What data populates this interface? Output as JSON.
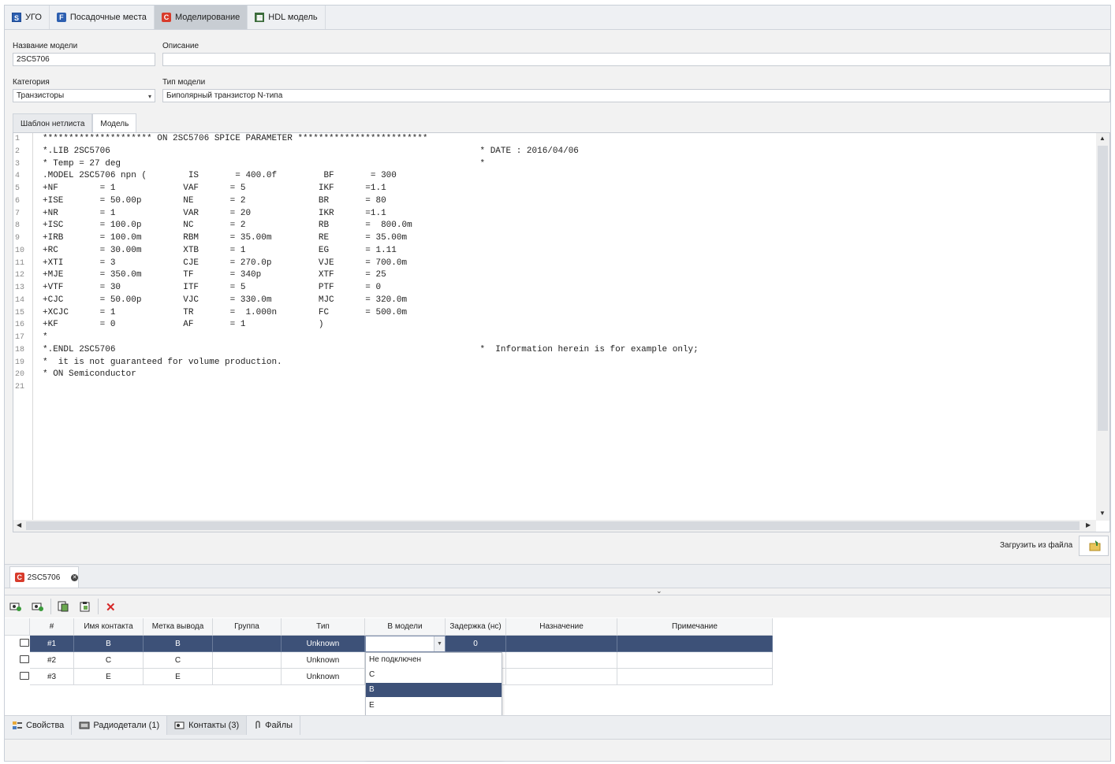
{
  "top_tabs": [
    {
      "label": "УГО",
      "icon": "s-icon"
    },
    {
      "label": "Посадочные места",
      "icon": "f-icon"
    },
    {
      "label": "Моделирование",
      "icon": "model-icon"
    },
    {
      "label": "HDL модель",
      "icon": "hdl-icon"
    }
  ],
  "form": {
    "model_name_label": "Название модели",
    "model_name_value": "2SC5706",
    "description_label": "Описание",
    "description_value": "",
    "category_label": "Категория",
    "category_value": "Транзисторы",
    "model_type_label": "Тип модели",
    "model_type_value": "Биполярный транзистор N-типа"
  },
  "inner_tabs": [
    {
      "label": "Шаблон нетлиста"
    },
    {
      "label": "Модель"
    }
  ],
  "code_lines": [
    "********************* ON 2SC5706 SPICE PARAMETER *************************",
    "*.LIB 2SC5706                                                                       * DATE : 2016/04/06",
    "* Temp = 27 deg                                                                     *",
    ".MODEL 2SC5706 npn (        IS       = 400.0f         BF       = 300",
    "+NF        = 1             VAF      = 5              IKF      =1.1",
    "+ISE       = 50.00p        NE       = 2              BR       = 80",
    "+NR        = 1             VAR      = 20             IKR      =1.1",
    "+ISC       = 100.0p        NC       = 2              RB       =  800.0m",
    "+IRB       = 100.0m        RBM      = 35.00m         RE       = 35.00m",
    "+RC        = 30.00m        XTB      = 1              EG       = 1.11",
    "+XTI       = 3             CJE      = 270.0p         VJE      = 700.0m",
    "+MJE       = 350.0m        TF       = 340p           XTF      = 25",
    "+VTF       = 30            ITF      = 5              PTF      = 0",
    "+CJC       = 50.00p        VJC      = 330.0m         MJC      = 320.0m",
    "+XCJC      = 1             TR       =  1.000n        FC       = 500.0m",
    "+KF        = 0             AF       = 1              )",
    "*",
    "*.ENDL 2SC5706                                                                      *  Information herein is for example only;",
    "*  it is not guaranteed for volume production.",
    "* ON Semiconductor",
    ""
  ],
  "line_numbers": [
    "1",
    "2",
    "3",
    "4",
    "5",
    "6",
    "7",
    "8",
    "9",
    "10",
    "11",
    "12",
    "13",
    "14",
    "15",
    "16",
    "17",
    "18",
    "19",
    "20",
    "21"
  ],
  "load_from_file_label": "Загрузить из файла",
  "doc_tab": {
    "label": "2SC5706",
    "icon": "model-icon"
  },
  "toolbar_icons": [
    "add-contact-icon",
    "add-contacts-icon",
    "copy-icon",
    "paste-icon",
    "delete-icon"
  ],
  "table": {
    "headers": [
      "#",
      "Имя контакта",
      "Метка вывода",
      "Группа",
      "Тип",
      "В модели",
      "Задержка (нс)",
      "Назначение",
      "Примечание"
    ],
    "rows": [
      {
        "num": "#1",
        "name": "B",
        "pin": "B",
        "group": "",
        "type": "Unknown",
        "model": "",
        "delay": "0",
        "purpose": "",
        "note": ""
      },
      {
        "num": "#2",
        "name": "C",
        "pin": "C",
        "group": "",
        "type": "Unknown",
        "model": "",
        "delay": "",
        "purpose": "",
        "note": ""
      },
      {
        "num": "#3",
        "name": "E",
        "pin": "E",
        "group": "",
        "type": "Unknown",
        "model": "",
        "delay": "",
        "purpose": "",
        "note": ""
      }
    ]
  },
  "dropdown_options": [
    "Не подключен",
    "C",
    "B",
    "E"
  ],
  "dropdown_selected": "B",
  "bottom_tabs": [
    {
      "label": "Свойства",
      "icon": "properties-icon"
    },
    {
      "label": "Радиодетали (1)",
      "icon": "components-icon"
    },
    {
      "label": "Контакты (3)",
      "icon": "contacts-icon"
    },
    {
      "label": "Файлы",
      "icon": "paperclip-icon"
    }
  ],
  "colors": {
    "selection": "#3d5178",
    "active_tab": "#c8cdd3",
    "delete_red": "#d62828"
  }
}
